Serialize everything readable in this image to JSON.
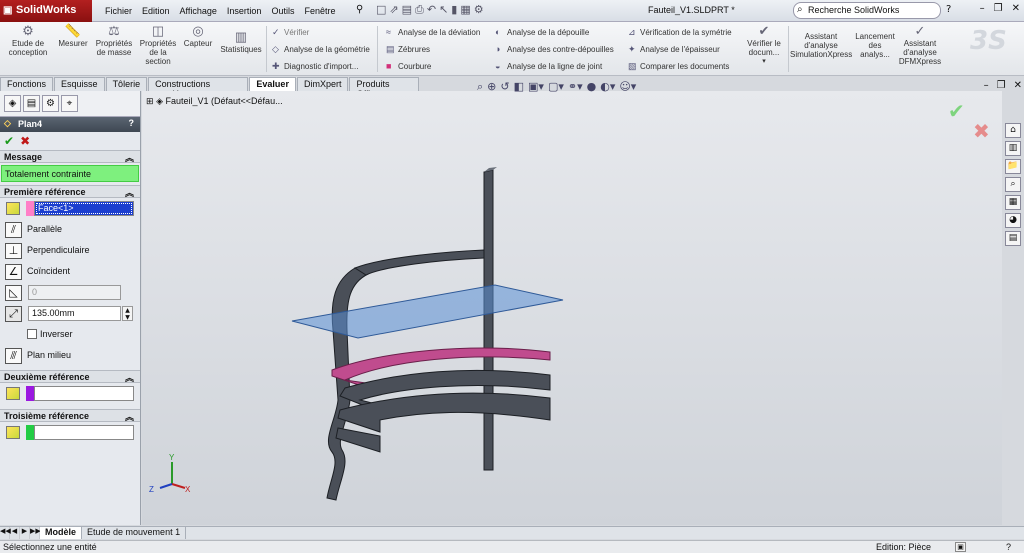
{
  "app": {
    "logo": "SolidWorks",
    "document_title": "Fauteil_V1.SLDPRT *"
  },
  "menu": [
    "Fichier",
    "Edition",
    "Affichage",
    "Insertion",
    "Outils",
    "Fenêtre"
  ],
  "search": {
    "placeholder": "Recherche SolidWorks"
  },
  "ribbon": {
    "large": [
      {
        "label": "Etude de conception",
        "icon": "design-study-icon"
      },
      {
        "label": "Mesurer",
        "icon": "measure-icon"
      },
      {
        "label": "Propriétés de masse",
        "icon": "mass-properties-icon"
      },
      {
        "label": "Propriétés de la section",
        "icon": "section-properties-icon"
      },
      {
        "label": "Capteur",
        "icon": "sensor-icon"
      },
      {
        "label": "Statistiques",
        "icon": "statistics-icon"
      }
    ],
    "col1": [
      "Vérifier",
      "Analyse de la géométrie",
      "Diagnostic d'import..."
    ],
    "col2": [
      "Analyse de la déviation",
      "Zébrures",
      "Courbure"
    ],
    "col3": [
      "Analyse de la dépouille",
      "Analyse des contre-dépouilles",
      "Analyse de la ligne de joint"
    ],
    "col4": [
      "Vérification de la symétrie",
      "Analyse de l'épaisseur",
      "Comparer les documents"
    ],
    "right": [
      {
        "label": "Vérifier le docum...",
        "icon": "check-document-icon"
      },
      {
        "label": "Assistant d'analyse SimulationXpress",
        "icon": "simulationxpress-icon"
      },
      {
        "label": "Lancement des analys...",
        "icon": "launch-analysis-icon"
      },
      {
        "label": "Assistant d'analyse DFMXpress",
        "icon": "dfmxpress-icon"
      }
    ]
  },
  "tabs": [
    "Fonctions",
    "Esquisse",
    "Tôlerie",
    "Constructions soudées",
    "Evaluer",
    "DimXpert",
    "Produits Office"
  ],
  "active_tab": "Evaluer",
  "property_manager": {
    "title": "Plan4",
    "help": "?",
    "message_header": "Message",
    "message": "Totalement contrainte",
    "first_ref": {
      "header": "Première référence",
      "selection": "Face<1>",
      "options": [
        "Parallèle",
        "Perpendiculaire",
        "Coïncident"
      ],
      "angle_value": "0",
      "distance_value": "135.00mm",
      "invert_label": "Inverser",
      "mid_plane_label": "Plan milieu"
    },
    "second_ref": {
      "header": "Deuxième référence"
    },
    "third_ref": {
      "header": "Troisième référence"
    }
  },
  "tree": {
    "label": "Fauteil_V1  (Défaut<<Défau..."
  },
  "bottom_tabs": [
    "Modèle",
    "Etude de mouvement 1"
  ],
  "status": {
    "left": "Sélectionnez une entité",
    "right": "Edition: Pièce",
    "help": "?"
  },
  "axis": {
    "x": "X",
    "y": "Y",
    "z": "Z"
  },
  "colors": {
    "message_bg": "#7ef07e",
    "selection_bg": "#1b3ecf",
    "ref1": "#ff7fc8",
    "ref2": "#9a18e0",
    "ref3": "#22cc44",
    "plane": "#5b8fd6",
    "highlight_face": "#c04c8e"
  }
}
